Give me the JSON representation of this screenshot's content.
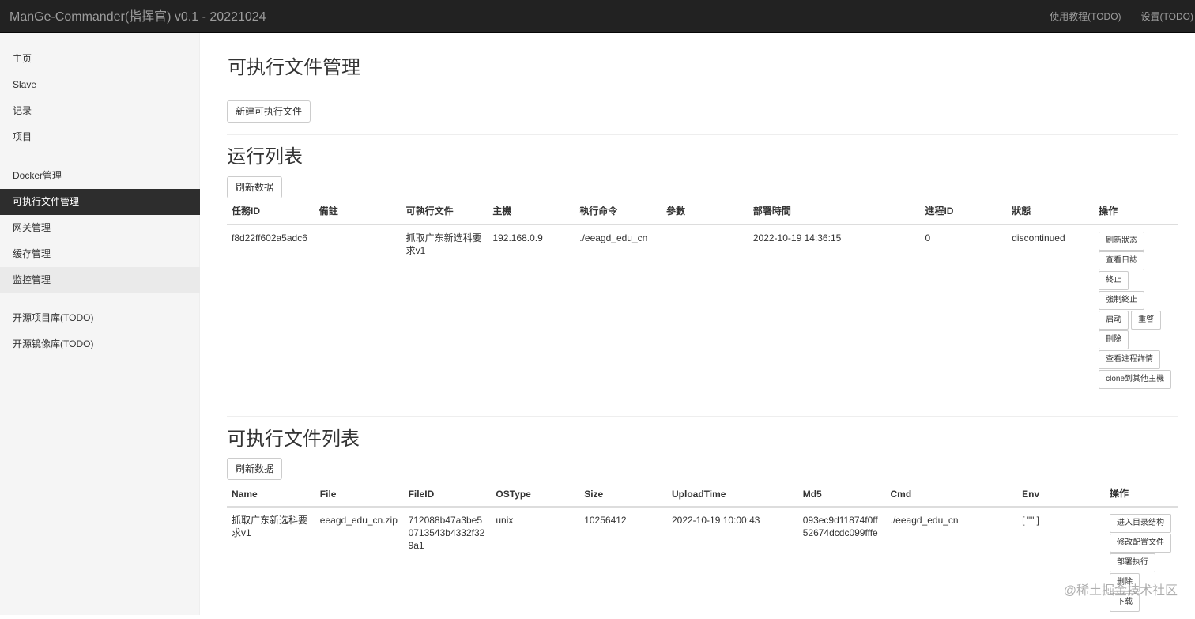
{
  "navbar": {
    "brand": "ManGe-Commander(指挥官) v0.1 - 20221024",
    "links": [
      "使用教程(TODO)",
      "设置(TODO)"
    ]
  },
  "sidebar": {
    "group1": [
      "主页",
      "Slave",
      "记录",
      "项目"
    ],
    "group2": [
      "Docker管理",
      "可执行文件管理",
      "网关管理",
      "缓存管理",
      "监控管理"
    ],
    "group3": [
      "开源项目库(TODO)",
      "开源镜像库(TODO)"
    ],
    "active": "可执行文件管理"
  },
  "main": {
    "title": "可执行文件管理",
    "new_button": "新建可执行文件",
    "run_section": {
      "title": "运行列表",
      "refresh_button": "刷新数据",
      "headers": [
        "任務ID",
        "備註",
        "可執行文件",
        "主機",
        "執行命令",
        "參數",
        "部署時間",
        "進程ID",
        "狀態",
        "操作"
      ],
      "rows": [
        {
          "task_id": "f8d22ff602a5adc6",
          "note": "",
          "executable": "抓取广东新选科要求v1",
          "host": "192.168.0.9",
          "command": "./eeagd_edu_cn",
          "params": "",
          "deploy_time": "2022-10-19 14:36:15",
          "pid": "0",
          "status": "discontinued",
          "actions": [
            "刷新狀态",
            "查看日誌",
            "終止",
            "強制終止",
            "启动",
            "重啓",
            "刪除",
            "查看進程詳情",
            "clone到其他主機"
          ]
        }
      ]
    },
    "file_section": {
      "title": "可执行文件列表",
      "refresh_button": "刷新数据",
      "headers": [
        "Name",
        "File",
        "FileID",
        "OSType",
        "Size",
        "UploadTime",
        "Md5",
        "Cmd",
        "Env",
        "操作"
      ],
      "rows": [
        {
          "name": "抓取广东新选科要求v1",
          "file": "eeagd_edu_cn.zip",
          "file_id": "712088b47a3be50713543b4332f329a1",
          "os_type": "unix",
          "size": "10256412",
          "upload_time": "2022-10-19 10:00:43",
          "md5": "093ec9d11874f0ff52674dcdc099fffe",
          "cmd": "./eeagd_edu_cn",
          "env": "[ \"\" ]",
          "actions": [
            "进入目录结构",
            "修改配置文件",
            "部署执行",
            "删除",
            "下载"
          ]
        }
      ]
    }
  },
  "watermark": "@稀土掘金技术社区"
}
